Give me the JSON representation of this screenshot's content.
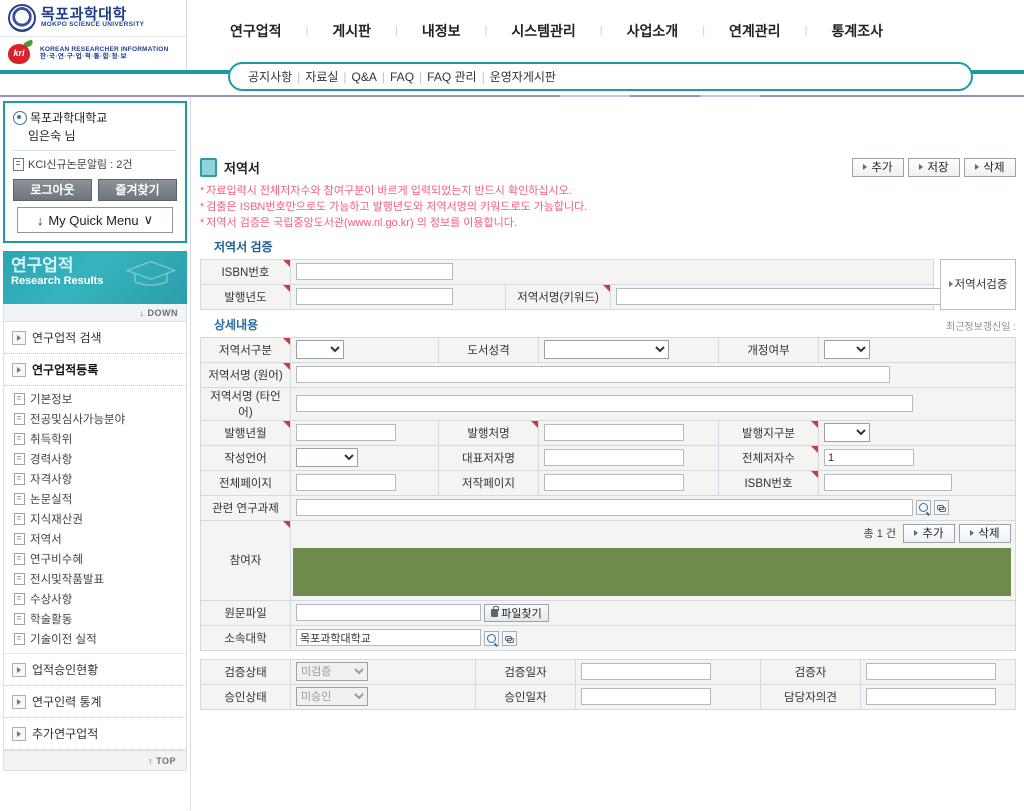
{
  "header": {
    "university_ko": "목포과학대학",
    "university_en": "MOKPO SCIENCE UNIVERSITY",
    "kri_en": "KOREAN RESEARCHER INFORMATION",
    "kri_ko": "한·국·연·구·업·적·통·합·정·보",
    "kri_mark": "kri",
    "gnb": [
      {
        "label": "연구업적"
      },
      {
        "label": "게시판"
      },
      {
        "label": "내정보"
      },
      {
        "label": "시스템관리"
      },
      {
        "label": "사업소개"
      },
      {
        "label": "연계관리"
      },
      {
        "label": "통계조사"
      }
    ],
    "subnav": [
      "공지사항",
      "자료실",
      "Q&A",
      "FAQ",
      "FAQ 관리",
      "운영자게시판"
    ]
  },
  "sidebar": {
    "user": {
      "affiliation": "목포과학대학교",
      "name": "임은숙 님",
      "alert": "KCI신규논문알림 : 2건",
      "logout_label": "로그아웃",
      "bookmark_label": "즐겨찾기",
      "quick_menu_label": "My Quick Menu",
      "quick_menu_arrow": "↓",
      "quick_menu_chevron": "∨"
    },
    "banner": {
      "title_ko": "연구업적",
      "title_en": "Research Results",
      "down_label": "DOWN"
    },
    "menu": [
      {
        "label": "연구업적 검색",
        "active": false
      },
      {
        "label": "연구업적등록",
        "active": true
      }
    ],
    "submenu": [
      "기본정보",
      "전공및심사가능분야",
      "취득학위",
      "경력사항",
      "자격사항",
      "논문실적",
      "지식재산권",
      "저역서",
      "연구비수혜",
      "전시및작품발표",
      "수상사항",
      "학술활동",
      "기술이전 실적"
    ],
    "menu_bottom": [
      {
        "label": "업적승인현황"
      },
      {
        "label": "연구인력 통계"
      },
      {
        "label": "추가연구업적"
      }
    ],
    "top_label": "TOP"
  },
  "main": {
    "page_title": "저역서",
    "actions": [
      {
        "label": "추가"
      },
      {
        "label": "저장"
      },
      {
        "label": "삭제"
      }
    ],
    "notices": [
      "자료입력시 전체저자수와 참여구분이 바르게 입력되었는지 반드시 확인하십시오.",
      "검출은 ISBN번호만으로도 가능하고 발행년도와 저역서명의 키워드로도 가능합니다.",
      "저역서 검증은 국립중앙도서관(www.nl.go.kr) 의 정보를 이용합니다."
    ],
    "search_section": {
      "title": "저역서 검증",
      "isbn_label": "ISBN번호",
      "isbn_value": "",
      "year_label": "발행년도",
      "year_value": "",
      "keyword_label": "저역서명(키워드)",
      "keyword_value": "",
      "verify_button": "저역서검증"
    },
    "detail_section": {
      "title": "상세내용",
      "update_label": "최근정보갱신일 :",
      "rows": {
        "type_label": "저역서구분",
        "type_value": "",
        "book_char_label": "도서성격",
        "book_char_value": "",
        "revision_label": "개정여부",
        "revision_value": "",
        "title_orig_label": "저역서명 (원어)",
        "title_orig_value": "",
        "title_other_label": "저역서명 (타언어)",
        "title_other_value": "",
        "pub_ym_label": "발행년월",
        "pub_ym_value": "",
        "publisher_label": "발행처명",
        "publisher_value": "",
        "pub_region_label": "발행지구분",
        "pub_region_value": "",
        "language_label": "작성언어",
        "language_value": "",
        "main_author_label": "대표저자명",
        "main_author_value": "",
        "author_count_label": "전체저자수",
        "author_count_value": "1",
        "total_pages_label": "전체페이지",
        "total_pages_value": "",
        "own_pages_label": "저작페이지",
        "own_pages_value": "",
        "isbn_label": "ISBN번호",
        "isbn_value": "",
        "project_label": "관련 연구과제",
        "project_value": "",
        "participants_label": "참여자",
        "participants_count": "총 1 건",
        "participants_add": "추가",
        "participants_del": "삭제",
        "file_label": "원문파일",
        "file_value": "",
        "file_button": "파일찾기",
        "school_label": "소속대학",
        "school_value": "목포과학대학교"
      }
    },
    "status_section": {
      "verify_state_label": "검증상태",
      "verify_state_value": "미검증",
      "verify_date_label": "검증일자",
      "verify_date_value": "",
      "verifier_label": "검증자",
      "verifier_value": "",
      "approve_state_label": "승인상태",
      "approve_state_value": "미승인",
      "approve_date_label": "승인일자",
      "approve_date_value": "",
      "opinion_label": "담당자의견",
      "opinion_value": ""
    }
  },
  "colors": {
    "teal": "#1a9ca8",
    "label_bg": "#dcd8d1",
    "field_bg": "#f4f4f2",
    "notice_red": "#f4607d",
    "participant_green": "#6e8b4e"
  }
}
